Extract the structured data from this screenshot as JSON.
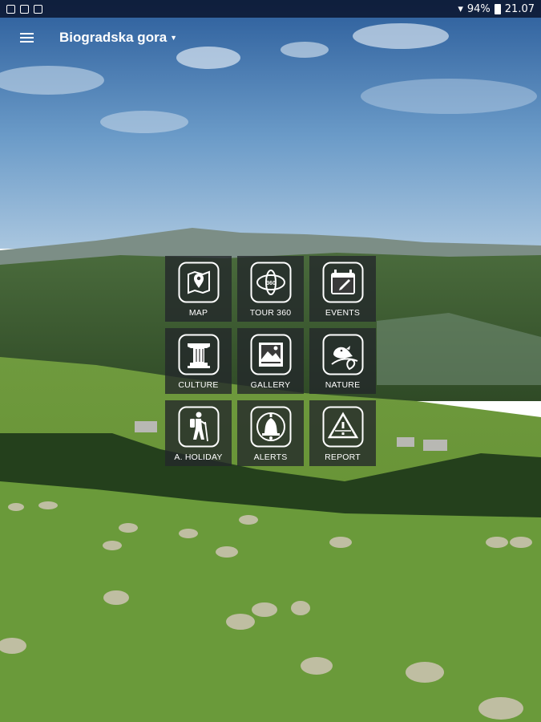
{
  "status_bar": {
    "battery": "94%",
    "time": "21.07"
  },
  "app_bar": {
    "menu_icon": "hamburger-menu-icon",
    "title": "Biogradska gora",
    "dropdown_icon": "caret-down-icon"
  },
  "tiles": [
    {
      "label": "MAP",
      "icon": "map-pin-icon"
    },
    {
      "label": "TOUR 360",
      "icon": "tour-360-icon"
    },
    {
      "label": "EVENTS",
      "icon": "calendar-icon"
    },
    {
      "label": "CULTURE",
      "icon": "column-icon"
    },
    {
      "label": "GALLERY",
      "icon": "picture-icon"
    },
    {
      "label": "NATURE",
      "icon": "bird-icon"
    },
    {
      "label": "A. HOLIDAY",
      "icon": "hiker-icon"
    },
    {
      "label": "ALERTS",
      "icon": "bell-icon"
    },
    {
      "label": "REPORT",
      "icon": "warning-icon"
    }
  ]
}
